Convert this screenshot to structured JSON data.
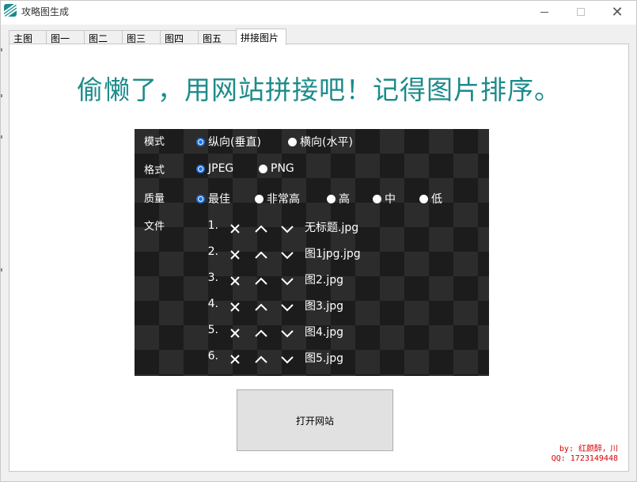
{
  "window": {
    "title": "攻略图生成"
  },
  "tabs": [
    {
      "label": "主图"
    },
    {
      "label": "图一"
    },
    {
      "label": "图二"
    },
    {
      "label": "图三"
    },
    {
      "label": "图四"
    },
    {
      "label": "图五"
    },
    {
      "label": "拼接图片"
    }
  ],
  "active_tab": "拼接图片",
  "headline": "偷懒了，用网站拼接吧！记得图片排序。",
  "options": {
    "mode": {
      "label": "模式",
      "choices": [
        "纵向(垂直)",
        "横向(水平)"
      ],
      "selected": "纵向(垂直)"
    },
    "format": {
      "label": "格式",
      "choices": [
        "JPEG",
        "PNG"
      ],
      "selected": "JPEG"
    },
    "quality": {
      "label": "质量",
      "choices": [
        "最佳",
        "非常高",
        "高",
        "中",
        "低"
      ],
      "selected": "最佳"
    },
    "files": {
      "label": "文件",
      "items": [
        {
          "num": "1.",
          "name": "无标题.jpg"
        },
        {
          "num": "2.",
          "name": "图1jpg.jpg"
        },
        {
          "num": "3.",
          "name": "图2.jpg"
        },
        {
          "num": "4.",
          "name": "图3.jpg"
        },
        {
          "num": "5.",
          "name": "图4.jpg"
        },
        {
          "num": "6.",
          "name": "图5.jpg"
        }
      ]
    }
  },
  "open_button": "打开网站",
  "credit": {
    "line1": "by: 红颜醉，川",
    "line2": "QQ: 1723149448"
  },
  "colors": {
    "headline": "#1d8b8b",
    "credit": "#d40000",
    "radio_selected": "#1f6fdc"
  }
}
